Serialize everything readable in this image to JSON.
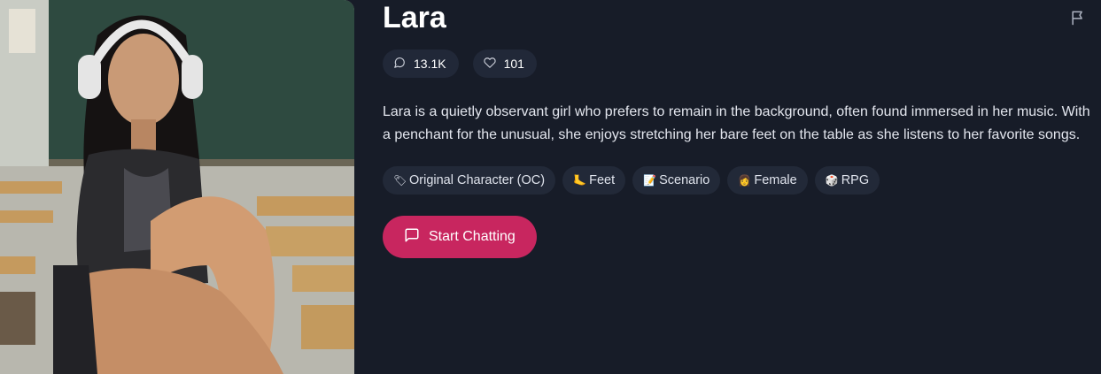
{
  "character": {
    "name": "Lara",
    "stats": {
      "messages": "13.1K",
      "likes": "101"
    },
    "description": "Lara is a quietly observant girl who prefers to remain in the background, often found immersed in her music. With a penchant for the unusual, she enjoys stretching her bare feet on the table as she listens to her favorite songs.",
    "tags": [
      {
        "emoji": "🏷",
        "label": "Original Character (OC)"
      },
      {
        "emoji": "🦶",
        "label": "Feet"
      },
      {
        "emoji": "📝",
        "label": "Scenario"
      },
      {
        "emoji": "👩",
        "label": "Female"
      },
      {
        "emoji": "🎲",
        "label": "RPG"
      }
    ],
    "cta_label": "Start Chatting"
  },
  "colors": {
    "background": "#171c28",
    "chip": "#212838",
    "accent": "#c8265f"
  },
  "icons": {
    "report": "flag-icon",
    "messages": "chat-bubble-icon",
    "likes": "heart-icon",
    "cta": "message-square-icon"
  }
}
